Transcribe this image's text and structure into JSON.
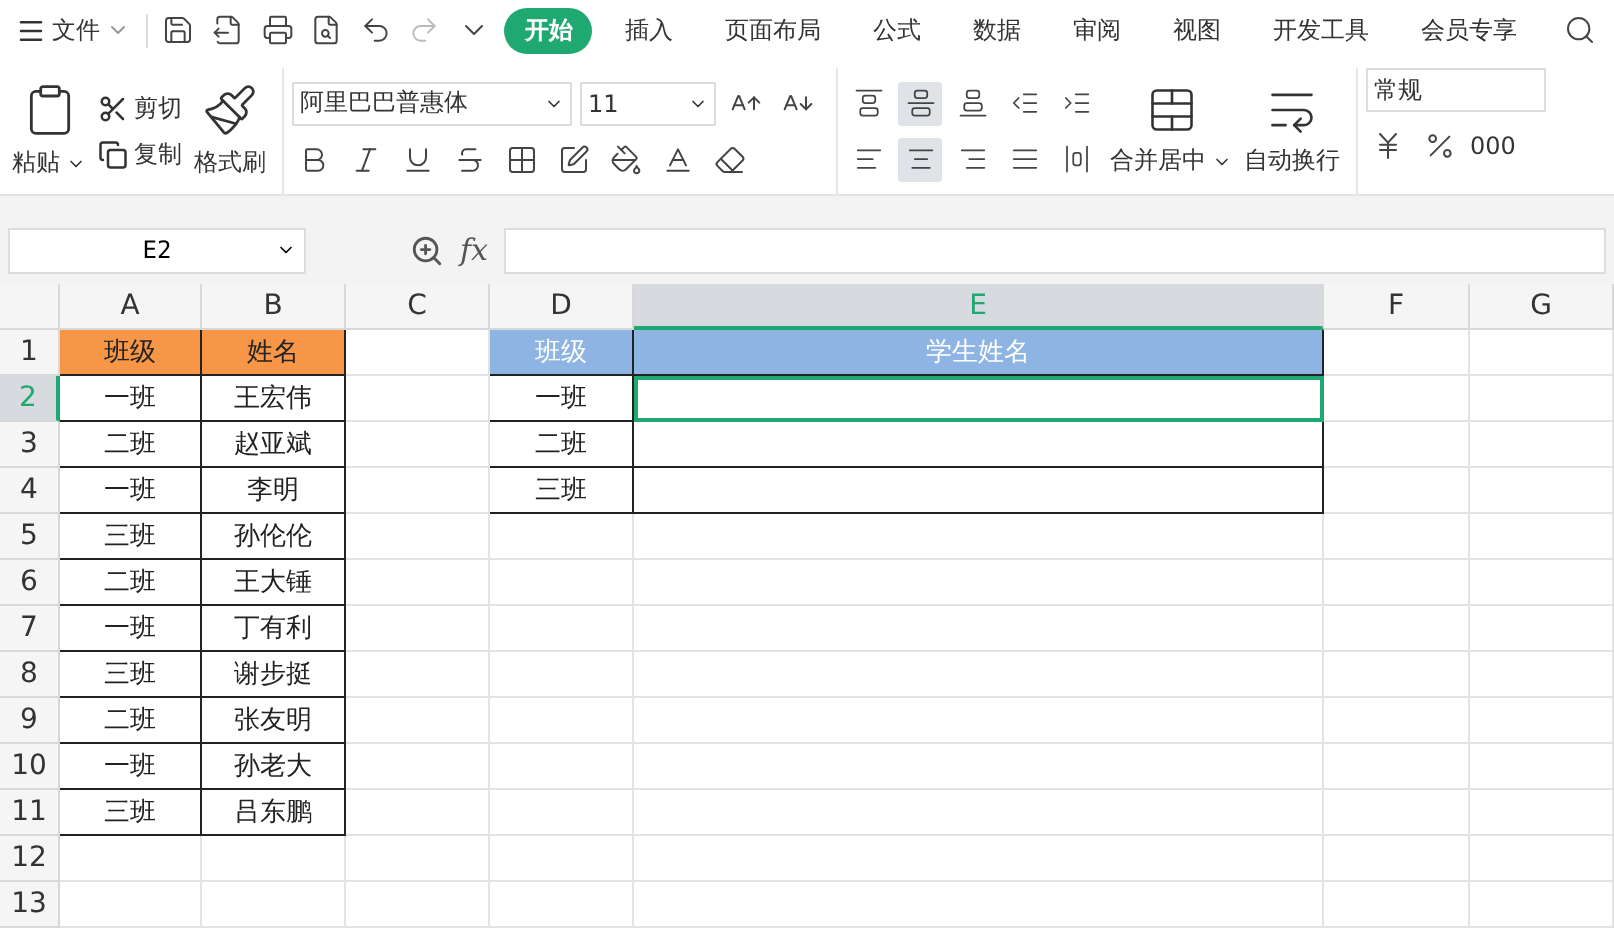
{
  "menu": {
    "file_label": "文件",
    "tabs": [
      {
        "label": "开始",
        "selected": true
      },
      {
        "label": "插入",
        "selected": false
      },
      {
        "label": "页面布局",
        "selected": false
      },
      {
        "label": "公式",
        "selected": false
      },
      {
        "label": "数据",
        "selected": false
      },
      {
        "label": "审阅",
        "selected": false
      },
      {
        "label": "视图",
        "selected": false
      },
      {
        "label": "开发工具",
        "selected": false
      },
      {
        "label": "会员专享",
        "selected": false
      }
    ]
  },
  "ribbon": {
    "paste": "粘贴",
    "cut": "剪切",
    "copy": "复制",
    "format_painter": "格式刷",
    "font_name": "阿里巴巴普惠体",
    "font_size": "11",
    "valign": [
      {
        "kind": "top",
        "selected": false
      },
      {
        "kind": "middle",
        "selected": true
      },
      {
        "kind": "bottom",
        "selected": false
      },
      {
        "kind": "outdent",
        "selected": false
      },
      {
        "kind": "indent",
        "selected": false
      }
    ],
    "halign": [
      {
        "kind": "left",
        "selected": false
      },
      {
        "kind": "center",
        "selected": true
      },
      {
        "kind": "right",
        "selected": false
      },
      {
        "kind": "justify",
        "selected": false
      },
      {
        "kind": "distributed",
        "selected": false
      }
    ],
    "merge": "合并居中",
    "wrap": "自动换行",
    "number_format": "常规",
    "thousands": "000"
  },
  "formula_bar": {
    "name_box": "E2",
    "fx": "fx"
  },
  "sheet": {
    "columns": [
      {
        "label": "A",
        "selected": false
      },
      {
        "label": "B",
        "selected": false
      },
      {
        "label": "C",
        "selected": false
      },
      {
        "label": "D",
        "selected": false
      },
      {
        "label": "E",
        "selected": true
      },
      {
        "label": "F",
        "selected": false
      },
      {
        "label": "G",
        "selected": false
      }
    ],
    "rows": [
      {
        "label": "1",
        "selected": false,
        "cells": [
          "班级",
          "姓名",
          "",
          "班级",
          "学生姓名",
          "",
          ""
        ]
      },
      {
        "label": "2",
        "selected": true,
        "cells": [
          "一班",
          "王宏伟",
          "",
          "一班",
          "",
          "",
          ""
        ]
      },
      {
        "label": "3",
        "selected": false,
        "cells": [
          "二班",
          "赵亚斌",
          "",
          "二班",
          "",
          "",
          ""
        ]
      },
      {
        "label": "4",
        "selected": false,
        "cells": [
          "一班",
          "李明",
          "",
          "三班",
          "",
          "",
          ""
        ]
      },
      {
        "label": "5",
        "selected": false,
        "cells": [
          "三班",
          "孙伦伦",
          "",
          "",
          "",
          "",
          ""
        ]
      },
      {
        "label": "6",
        "selected": false,
        "cells": [
          "二班",
          "王大锤",
          "",
          "",
          "",
          "",
          ""
        ]
      },
      {
        "label": "7",
        "selected": false,
        "cells": [
          "一班",
          "丁有利",
          "",
          "",
          "",
          "",
          ""
        ]
      },
      {
        "label": "8",
        "selected": false,
        "cells": [
          "三班",
          "谢步挺",
          "",
          "",
          "",
          "",
          ""
        ]
      },
      {
        "label": "9",
        "selected": false,
        "cells": [
          "二班",
          "张友明",
          "",
          "",
          "",
          "",
          ""
        ]
      },
      {
        "label": "10",
        "selected": false,
        "cells": [
          "一班",
          "孙老大",
          "",
          "",
          "",
          "",
          ""
        ]
      },
      {
        "label": "11",
        "selected": false,
        "cells": [
          "三班",
          "吕东鹏",
          "",
          "",
          "",
          "",
          ""
        ]
      },
      {
        "label": "12",
        "selected": false,
        "cells": [
          "",
          "",
          "",
          "",
          "",
          "",
          ""
        ]
      },
      {
        "label": "13",
        "selected": false,
        "cells": [
          "",
          "",
          "",
          "",
          "",
          "",
          ""
        ]
      }
    ]
  }
}
